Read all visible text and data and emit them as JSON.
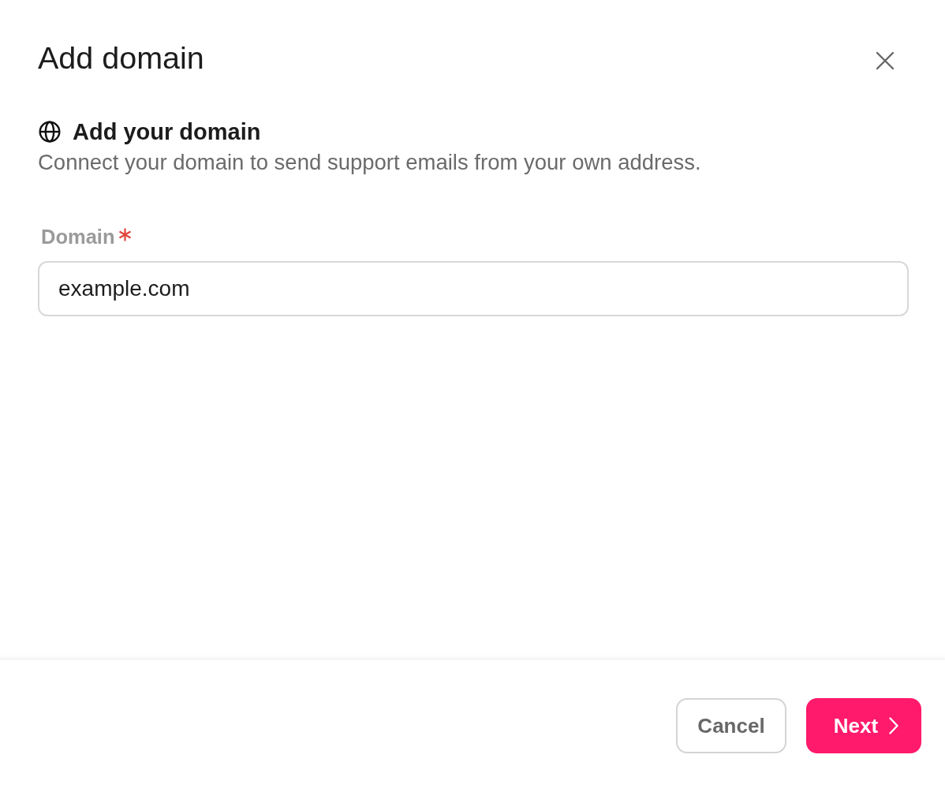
{
  "dialog": {
    "title": "Add domain"
  },
  "section": {
    "heading": "Add your domain",
    "description": "Connect your domain to send support emails from your own address."
  },
  "field": {
    "label": "Domain",
    "required": true,
    "value": "example.com"
  },
  "buttons": [
    {
      "label": "Cancel",
      "kind": "secondary"
    },
    {
      "label": "Next",
      "kind": "primary"
    }
  ]
}
